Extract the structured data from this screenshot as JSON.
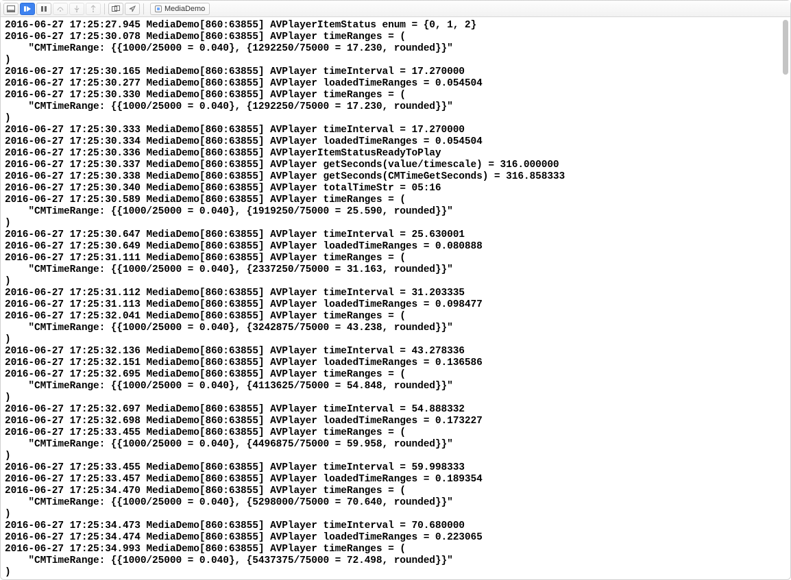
{
  "toolbar": {
    "scheme_label": "MediaDemo"
  },
  "log_prefix": {
    "date": "2016-06-27",
    "app": "MediaDemo",
    "pid": "[860:63855]"
  },
  "log_entries": [
    {
      "t": "17:25:27.945",
      "msg": "AVPlayerItemStatus enum = {0, 1, 2}"
    },
    {
      "t": "17:25:30.078",
      "msg": "AVPlayer timeRanges = ("
    },
    {
      "raw": "    \"CMTimeRange: {{1000/25000 = 0.040}, {1292250/75000 = 17.230, rounded}}\""
    },
    {
      "raw": ")"
    },
    {
      "t": "17:25:30.165",
      "msg": "AVPlayer timeInterval = 17.270000"
    },
    {
      "t": "17:25:30.277",
      "msg": "AVPlayer loadedTimeRanges = 0.054504"
    },
    {
      "t": "17:25:30.330",
      "msg": "AVPlayer timeRanges = ("
    },
    {
      "raw": "    \"CMTimeRange: {{1000/25000 = 0.040}, {1292250/75000 = 17.230, rounded}}\""
    },
    {
      "raw": ")"
    },
    {
      "t": "17:25:30.333",
      "msg": "AVPlayer timeInterval = 17.270000"
    },
    {
      "t": "17:25:30.334",
      "msg": "AVPlayer loadedTimeRanges = 0.054504"
    },
    {
      "t": "17:25:30.336",
      "msg": "AVPlayerItemStatusReadyToPlay"
    },
    {
      "t": "17:25:30.337",
      "msg": "AVPlayer getSeconds(value/timescale) = 316.000000"
    },
    {
      "t": "17:25:30.338",
      "msg": "AVPlayer getSeconds(CMTimeGetSeconds) = 316.858333"
    },
    {
      "t": "17:25:30.340",
      "msg": "AVPlayer totalTimeStr = 05:16"
    },
    {
      "t": "17:25:30.589",
      "msg": "AVPlayer timeRanges = ("
    },
    {
      "raw": "    \"CMTimeRange: {{1000/25000 = 0.040}, {1919250/75000 = 25.590, rounded}}\""
    },
    {
      "raw": ")"
    },
    {
      "t": "17:25:30.647",
      "msg": "AVPlayer timeInterval = 25.630001"
    },
    {
      "t": "17:25:30.649",
      "msg": "AVPlayer loadedTimeRanges = 0.080888"
    },
    {
      "t": "17:25:31.111",
      "msg": "AVPlayer timeRanges = ("
    },
    {
      "raw": "    \"CMTimeRange: {{1000/25000 = 0.040}, {2337250/75000 = 31.163, rounded}}\""
    },
    {
      "raw": ")"
    },
    {
      "t": "17:25:31.112",
      "msg": "AVPlayer timeInterval = 31.203335"
    },
    {
      "t": "17:25:31.113",
      "msg": "AVPlayer loadedTimeRanges = 0.098477"
    },
    {
      "t": "17:25:32.041",
      "msg": "AVPlayer timeRanges = ("
    },
    {
      "raw": "    \"CMTimeRange: {{1000/25000 = 0.040}, {3242875/75000 = 43.238, rounded}}\""
    },
    {
      "raw": ")"
    },
    {
      "t": "17:25:32.136",
      "msg": "AVPlayer timeInterval = 43.278336"
    },
    {
      "t": "17:25:32.151",
      "msg": "AVPlayer loadedTimeRanges = 0.136586"
    },
    {
      "t": "17:25:32.695",
      "msg": "AVPlayer timeRanges = ("
    },
    {
      "raw": "    \"CMTimeRange: {{1000/25000 = 0.040}, {4113625/75000 = 54.848, rounded}}\""
    },
    {
      "raw": ")"
    },
    {
      "t": "17:25:32.697",
      "msg": "AVPlayer timeInterval = 54.888332"
    },
    {
      "t": "17:25:32.698",
      "msg": "AVPlayer loadedTimeRanges = 0.173227"
    },
    {
      "t": "17:25:33.455",
      "msg": "AVPlayer timeRanges = ("
    },
    {
      "raw": "    \"CMTimeRange: {{1000/25000 = 0.040}, {4496875/75000 = 59.958, rounded}}\""
    },
    {
      "raw": ")"
    },
    {
      "t": "17:25:33.455",
      "msg": "AVPlayer timeInterval = 59.998333"
    },
    {
      "t": "17:25:33.457",
      "msg": "AVPlayer loadedTimeRanges = 0.189354"
    },
    {
      "t": "17:25:34.470",
      "msg": "AVPlayer timeRanges = ("
    },
    {
      "raw": "    \"CMTimeRange: {{1000/25000 = 0.040}, {5298000/75000 = 70.640, rounded}}\""
    },
    {
      "raw": ")"
    },
    {
      "t": "17:25:34.473",
      "msg": "AVPlayer timeInterval = 70.680000"
    },
    {
      "t": "17:25:34.474",
      "msg": "AVPlayer loadedTimeRanges = 0.223065"
    },
    {
      "t": "17:25:34.993",
      "msg": "AVPlayer timeRanges = ("
    },
    {
      "raw": "    \"CMTimeRange: {{1000/25000 = 0.040}, {5437375/75000 = 72.498, rounded}}\""
    },
    {
      "raw": ")"
    }
  ]
}
